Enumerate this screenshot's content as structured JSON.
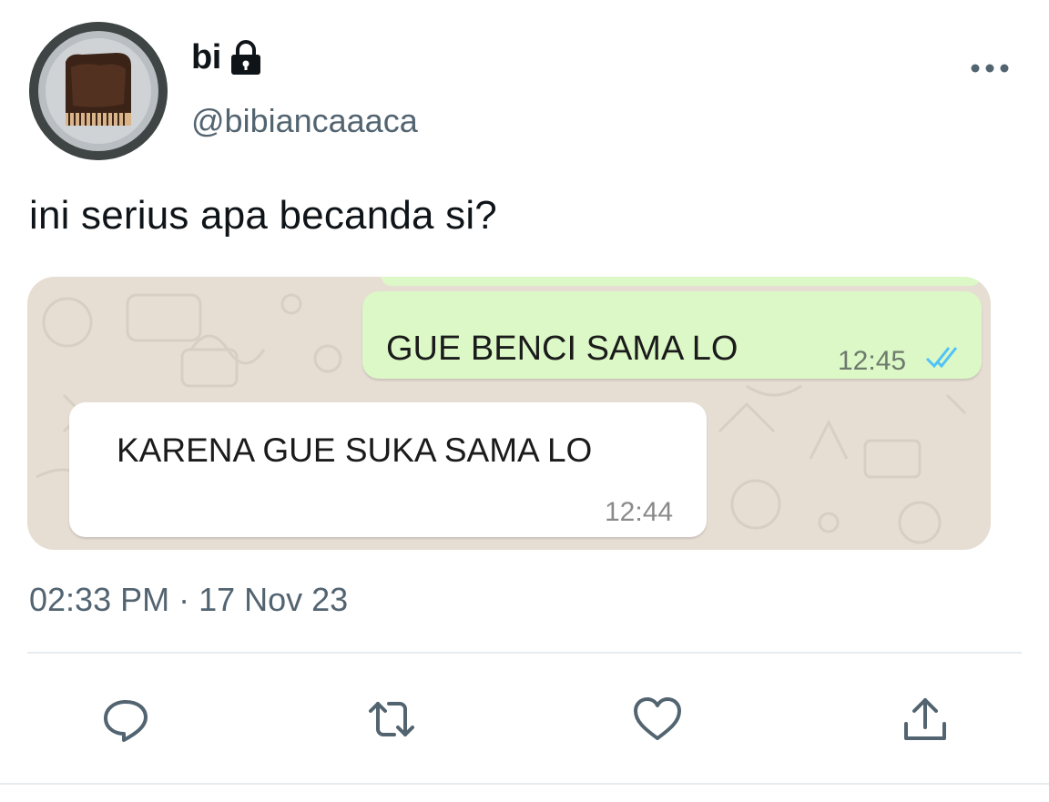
{
  "tweet": {
    "display_name": "bi",
    "handle": "@bibiancaaaca",
    "protected": true,
    "text": "ini serius apa becanda si?",
    "timestamp": "02:33 PM · 17 Nov 23"
  },
  "media": {
    "messages": [
      {
        "direction": "outgoing",
        "text": "GUE BENCI SAMA LO",
        "time": "12:45",
        "read": true
      },
      {
        "direction": "incoming",
        "text": "KARENA GUE SUKA SAMA LO",
        "time": "12:44"
      }
    ]
  },
  "actions": [
    {
      "icon": "reply-icon"
    },
    {
      "icon": "retweet-icon"
    },
    {
      "icon": "like-icon"
    },
    {
      "icon": "share-icon"
    }
  ],
  "colors": {
    "secondary_text": "#536471",
    "outgoing_bubble": "#dcf8c6",
    "chat_background": "#e6ddd3",
    "read_ticks": "#4fc3f7"
  }
}
